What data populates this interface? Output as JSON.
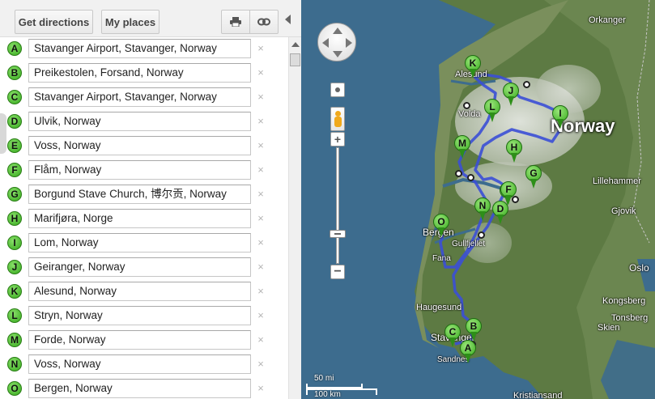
{
  "toolbar": {
    "get_directions_label": "Get directions",
    "my_places_label": "My places",
    "print_icon": "print-icon",
    "link_icon": "link-icon"
  },
  "stops": [
    {
      "letter": "A",
      "value": "Stavanger Airport, Stavanger, Norway"
    },
    {
      "letter": "B",
      "value": "Preikestolen, Forsand, Norway"
    },
    {
      "letter": "C",
      "value": "Stavanger Airport, Stavanger, Norway"
    },
    {
      "letter": "D",
      "value": "Ulvik, Norway"
    },
    {
      "letter": "E",
      "value": "Voss, Norway"
    },
    {
      "letter": "F",
      "value": "Flåm, Norway"
    },
    {
      "letter": "G",
      "value": "Borgund Stave Church, 博尔贡, Norway"
    },
    {
      "letter": "H",
      "value": "Marifjøra, Norge"
    },
    {
      "letter": "I",
      "value": "Lom, Norway"
    },
    {
      "letter": "J",
      "value": "Geiranger, Norway"
    },
    {
      "letter": "K",
      "value": "Alesund, Norway"
    },
    {
      "letter": "L",
      "value": "Stryn, Norway"
    },
    {
      "letter": "M",
      "value": "Forde, Norway"
    },
    {
      "letter": "N",
      "value": "Voss, Norway"
    },
    {
      "letter": "O",
      "value": "Bergen, Norway"
    }
  ],
  "remove_glyph": "×",
  "map": {
    "country_label": "Norway",
    "places": {
      "orkanger": "Orkanger",
      "alesund": "Alesund",
      "volda": "Volda",
      "lillehammer": "Lillehammer",
      "gjovik": "Gjovik",
      "bergen": "Bergen",
      "gullfjellet": "Gullfjellet",
      "fana": "Fana",
      "haugesund": "Haugesund",
      "oslo": "Oslo",
      "kongsberg": "Kongsberg",
      "tonsberg": "Tonsberg",
      "skien": "Skien",
      "stavanger": "Stavanger",
      "sandnes": "Sandnes",
      "kristiansand": "Kristiansand"
    },
    "scale_mi": "50 mi",
    "scale_km": "100 km",
    "colors": {
      "route": "#3b4fd6",
      "pin": "#4cbb2c"
    }
  }
}
